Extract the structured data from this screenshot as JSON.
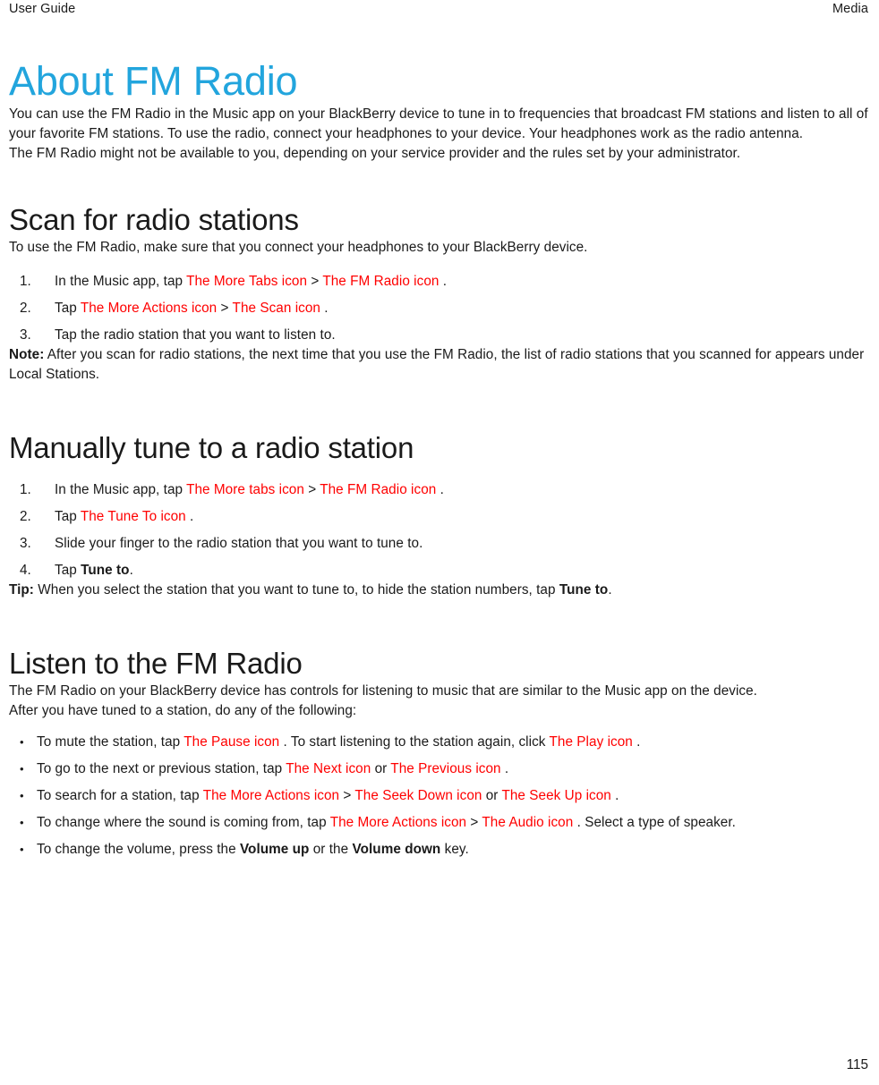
{
  "header": {
    "left": "User Guide",
    "right": "Media"
  },
  "colors": {
    "title_blue": "#22a5dd",
    "icon_red": "#ff0000",
    "text": "#1a1a1a"
  },
  "doc": {
    "title": "About FM Radio",
    "intro_paragraph": "You can use the FM Radio in the Music app on your BlackBerry device to tune in to frequencies that broadcast FM stations and listen to all of your favorite FM stations. To use the radio, connect your headphones to your device. Your headphones work as the radio antenna.",
    "availability_paragraph": "The FM Radio might not be available to you, depending on your service provider and the rules set by your administrator."
  },
  "scan_section": {
    "heading": "Scan for radio stations",
    "lead": "To use the FM Radio, make sure that you connect your headphones to your BlackBerry device.",
    "steps": [
      {
        "number": "1.",
        "parts": [
          {
            "type": "text",
            "value": "In the Music app, tap "
          },
          {
            "type": "icon",
            "value": "The More Tabs icon"
          },
          {
            "type": "text",
            "value": " > "
          },
          {
            "type": "icon",
            "value": "The FM Radio icon"
          },
          {
            "type": "text",
            "value": " ."
          }
        ]
      },
      {
        "number": "2.",
        "parts": [
          {
            "type": "text",
            "value": "Tap "
          },
          {
            "type": "icon",
            "value": "The More Actions icon"
          },
          {
            "type": "text",
            "value": " > "
          },
          {
            "type": "icon",
            "value": "The Scan icon"
          },
          {
            "type": "text",
            "value": " ."
          }
        ]
      },
      {
        "number": "3.",
        "parts": [
          {
            "type": "text",
            "value": "Tap the radio station that you want to listen to."
          }
        ]
      }
    ],
    "note_label": "Note:",
    "note_text": " After you scan for radio stations, the next time that you use the FM Radio, the list of radio stations that you scanned for appears under Local Stations."
  },
  "manual_section": {
    "heading": "Manually tune to a radio station",
    "steps": [
      {
        "number": "1.",
        "parts": [
          {
            "type": "text",
            "value": "In the Music app, tap "
          },
          {
            "type": "icon",
            "value": "The More tabs icon"
          },
          {
            "type": "text",
            "value": " > "
          },
          {
            "type": "icon",
            "value": "The FM Radio icon"
          },
          {
            "type": "text",
            "value": " ."
          }
        ]
      },
      {
        "number": "2.",
        "parts": [
          {
            "type": "text",
            "value": "Tap "
          },
          {
            "type": "icon",
            "value": "The Tune To icon"
          },
          {
            "type": "text",
            "value": " ."
          }
        ]
      },
      {
        "number": "3.",
        "parts": [
          {
            "type": "text",
            "value": "Slide your finger to the radio station that you want to tune to."
          }
        ]
      },
      {
        "number": "4.",
        "parts": [
          {
            "type": "text",
            "value": "Tap "
          },
          {
            "type": "bold",
            "value": "Tune to"
          },
          {
            "type": "text",
            "value": "."
          }
        ]
      }
    ],
    "tip_label": "Tip:",
    "tip_parts": [
      {
        "type": "text",
        "value": " When you select the station that you want to tune to, to hide the station numbers, tap "
      },
      {
        "type": "bold",
        "value": "Tune to"
      },
      {
        "type": "text",
        "value": "."
      }
    ]
  },
  "listen_section": {
    "heading": "Listen to the FM Radio",
    "lead": "The FM Radio on your BlackBerry device has controls for listening to music that are similar to the Music app on the device.",
    "lead2": "After you have tuned to a station, do any of the following:",
    "bullet_glyph": "•",
    "bullets": [
      {
        "parts": [
          {
            "type": "text",
            "value": "To mute the station, tap "
          },
          {
            "type": "icon",
            "value": "The Pause icon"
          },
          {
            "type": "text",
            "value": " . To start listening to the station again, click "
          },
          {
            "type": "icon",
            "value": "The Play icon"
          },
          {
            "type": "text",
            "value": " ."
          }
        ]
      },
      {
        "parts": [
          {
            "type": "text",
            "value": "To go to the next or previous station, tap "
          },
          {
            "type": "icon",
            "value": "The Next icon"
          },
          {
            "type": "text",
            "value": " or "
          },
          {
            "type": "icon",
            "value": "The Previous icon"
          },
          {
            "type": "text",
            "value": " ."
          }
        ]
      },
      {
        "parts": [
          {
            "type": "text",
            "value": "To search for a station, tap "
          },
          {
            "type": "icon",
            "value": "The More Actions icon"
          },
          {
            "type": "text",
            "value": " > "
          },
          {
            "type": "icon",
            "value": "The Seek Down icon"
          },
          {
            "type": "text",
            "value": " or "
          },
          {
            "type": "icon",
            "value": "The Seek Up icon"
          },
          {
            "type": "text",
            "value": " ."
          }
        ]
      },
      {
        "parts": [
          {
            "type": "text",
            "value": "To change where the sound is coming from, tap "
          },
          {
            "type": "icon",
            "value": "The More Actions icon"
          },
          {
            "type": "text",
            "value": " > "
          },
          {
            "type": "icon",
            "value": "The Audio icon"
          },
          {
            "type": "text",
            "value": " . Select a type of speaker."
          }
        ]
      },
      {
        "parts": [
          {
            "type": "text",
            "value": " To change the volume, press the "
          },
          {
            "type": "bold",
            "value": "Volume up"
          },
          {
            "type": "text",
            "value": " or the "
          },
          {
            "type": "bold",
            "value": "Volume down"
          },
          {
            "type": "text",
            "value": " key."
          }
        ]
      }
    ]
  },
  "footer": {
    "page_number": "115"
  }
}
